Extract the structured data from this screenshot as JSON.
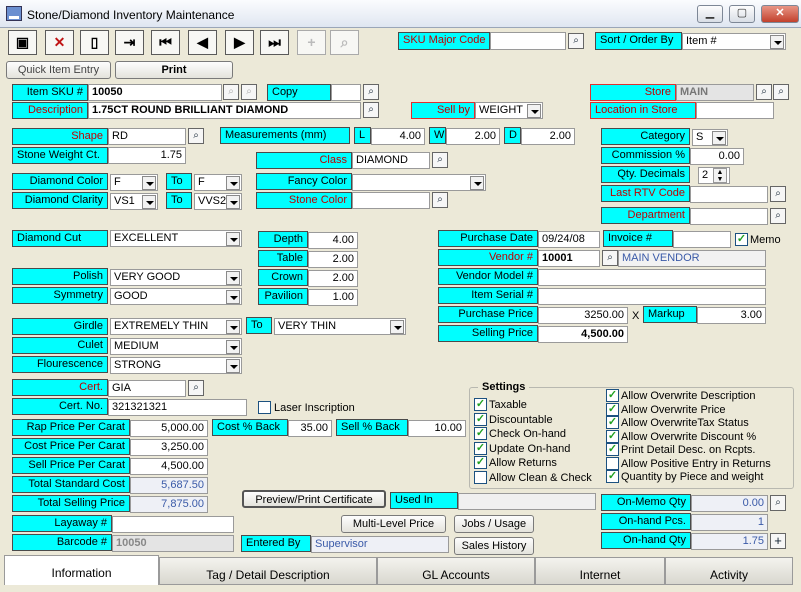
{
  "window": {
    "title": "Stone/Diamond Inventory Maintenance",
    "min": "▁",
    "max": "▢",
    "close": "✕"
  },
  "toolbar": {
    "sku_major_code_label": "SKU Major Code",
    "sku_major_code_value": "",
    "sort_label": "Sort / Order By",
    "sort_value": "Item #",
    "quick_entry": "Quick Item Entry",
    "print": "Print"
  },
  "item": {
    "sku_label": "Item SKU #",
    "sku": "10050",
    "copy": "Copy",
    "copy_value": "",
    "store_label": "Store",
    "store": "MAIN",
    "desc_label": "Description",
    "desc": "1.75CT ROUND BRILLIANT DIAMOND",
    "sell_by_label": "Sell by",
    "sell_by": "WEIGHT",
    "location_label": "Location in Store",
    "location": ""
  },
  "stone": {
    "shape_label": "Shape",
    "shape": "RD",
    "weight_label": "Stone Weight Ct.",
    "weight": "1.75",
    "meas_label": "Measurements (mm)",
    "l_label": "L",
    "l": "4.00",
    "w_label": "W",
    "w": "2.00",
    "d_label": "D",
    "d": "2.00",
    "class_label": "Class",
    "class": "DIAMOND",
    "category_label": "Category",
    "category": "S",
    "commission_label": "Commission %",
    "commission": "0.00",
    "qty_dec_label": "Qty. Decimals",
    "qty_dec": "2",
    "last_rtv_label": "Last RTV Code",
    "last_rtv": "",
    "dept_label": "Department",
    "dept": "",
    "color_label": "Diamond Color",
    "color": "F",
    "color_to_label": "To",
    "color_to": "F",
    "clarity_label": "Diamond Clarity",
    "clarity": "VS1",
    "clarity_to_label": "To",
    "clarity_to": "VVS2",
    "fancy_label": "Fancy Color",
    "fancy": "",
    "stone_color_label": "Stone Color",
    "stone_color": ""
  },
  "cut": {
    "cut_label": "Diamond Cut",
    "cut": "EXCELLENT",
    "depth_label": "Depth",
    "depth": "4.00",
    "table_label": "Table",
    "table": "2.00",
    "crown_label": "Crown",
    "crown": "2.00",
    "pavilion_label": "Pavilion",
    "pavilion": "1.00",
    "polish_label": "Polish",
    "polish": "VERY GOOD",
    "symmetry_label": "Symmetry",
    "symmetry": "GOOD",
    "girdle_label": "Girdle",
    "girdle": "EXTREMELY THIN",
    "girdle_to_label": "To",
    "girdle_to": "VERY THIN",
    "culet_label": "Culet",
    "culet": "MEDIUM",
    "fluor_label": "Flourescence",
    "fluor": "STRONG",
    "cert_label": "Cert.",
    "cert": "GIA",
    "certno_label": "Cert. No.",
    "certno": "321321321",
    "laser_label": "Laser Inscription"
  },
  "purchase": {
    "date_label": "Purchase Date",
    "date": "09/24/08",
    "invoice_label": "Invoice #",
    "invoice": "",
    "memo_label": "Memo",
    "vendor_label": "Vendor #",
    "vendor": "10001",
    "vendor_name": "MAIN VENDOR",
    "vendor_model_label": "Vendor Model #",
    "vendor_model": "",
    "serial_label": "Item Serial #",
    "serial": "",
    "price_label": "Purchase Price",
    "price": "3250.00",
    "x": "X",
    "markup_label": "Markup",
    "markup": "3.00",
    "selling_label": "Selling Price",
    "selling": "4,500.00"
  },
  "pricing": {
    "rap_label": "Rap Price Per Carat",
    "rap": "5,000.00",
    "cost_label": "Cost Price Per Carat",
    "cost": "3,250.00",
    "sell_label": "Sell Price Per Carat",
    "sell": "4,500.00",
    "total_cost_label": "Total Standard Cost",
    "total_cost": "5,687.50",
    "total_sell_label": "Total Selling Price",
    "total_sell": "7,875.00",
    "cost_back_label": "Cost % Back",
    "cost_back": "35.00",
    "sell_back_label": "Sell % Back",
    "sell_back": "10.00",
    "layaway_label": "Layaway #",
    "layaway": "",
    "barcode_label": "Barcode #",
    "barcode": "10050",
    "entered_label": "Entered By",
    "entered": "Supervisor"
  },
  "buttons": {
    "preview": "Preview/Print Certificate",
    "multilevel": "Multi-Level Price",
    "jobs": "Jobs / Usage",
    "history": "Sales History",
    "used_in_label": "Used In",
    "used_in": ""
  },
  "settings": {
    "title": "Settings",
    "left": [
      "Taxable",
      "Discountable",
      "Check On-hand",
      "Update On-hand",
      "Allow Returns",
      "Allow Clean & Check"
    ],
    "left_checked": [
      true,
      true,
      true,
      true,
      true,
      false
    ],
    "right": [
      "Allow Overwrite Description",
      "Allow Overwrite Price",
      "Allow OverwriteTax Status",
      "Allow Overwrite Discount %",
      "Print Detail Desc. on Rcpts.",
      "Allow Positive Entry in Returns",
      "Quantity by Piece and weight"
    ],
    "right_checked": [
      true,
      true,
      true,
      true,
      true,
      false,
      true
    ]
  },
  "qty": {
    "memo_label": "On-Memo Qty",
    "memo": "0.00",
    "pcs_label": "On-hand Pcs.",
    "pcs": "1",
    "qty_label": "On-hand Qty",
    "qty": "1.75"
  },
  "tabs": [
    "Information",
    "Tag / Detail Description",
    "GL Accounts",
    "Internet",
    "Activity"
  ]
}
